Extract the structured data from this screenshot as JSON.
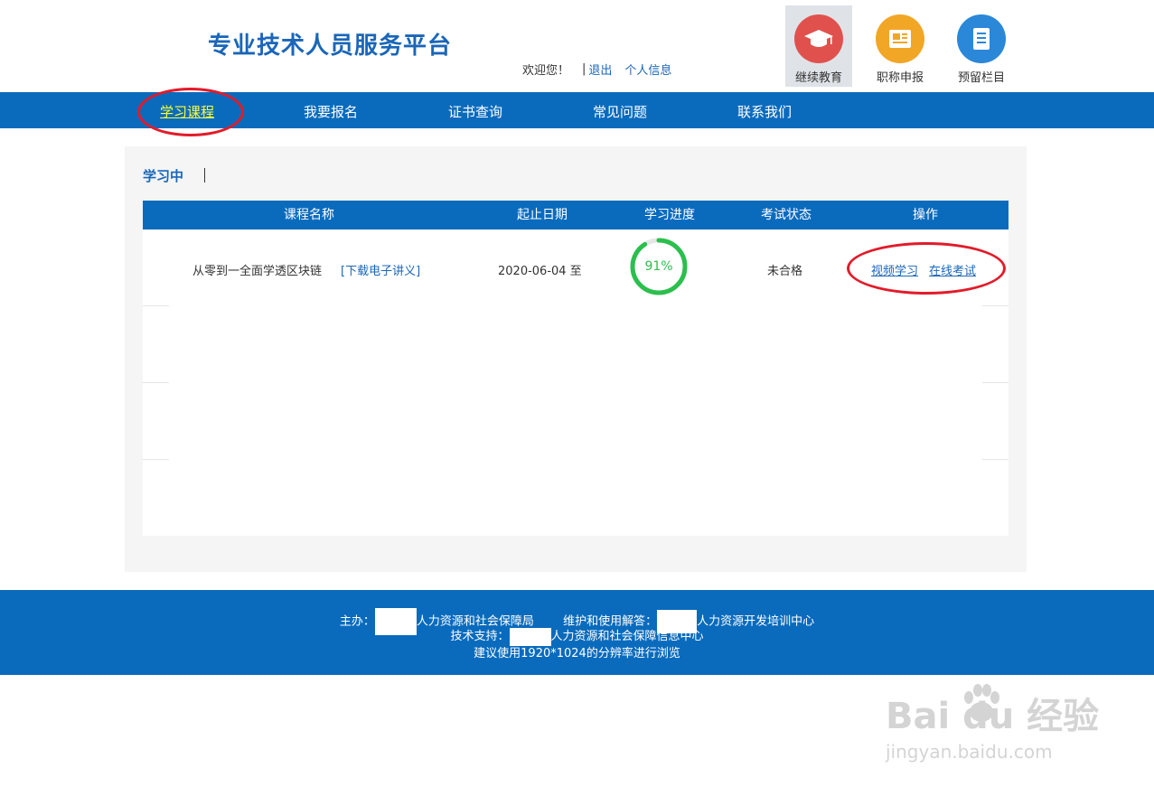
{
  "header": {
    "site_title": "专业技术人员服务平台",
    "welcome": "欢迎您！",
    "sep": "|",
    "logout": "退出",
    "profile": "个人信息"
  },
  "top_icons": [
    {
      "label": "继续教育",
      "icon": "graduation-cap-icon",
      "color": "#e0514e",
      "active": true
    },
    {
      "label": "职称申报",
      "icon": "newspaper-icon",
      "color": "#f2a626",
      "active": false
    },
    {
      "label": "预留栏目",
      "icon": "document-icon",
      "color": "#2b87d8",
      "active": false
    }
  ],
  "nav": {
    "items": [
      "学习课程",
      "我要报名",
      "证书查询",
      "常见问题",
      "联系我们"
    ],
    "active_index": 0
  },
  "panel": {
    "tab_label": "学习中",
    "tab_sep": "|",
    "columns": [
      "课程名称",
      "起止日期",
      "学习进度",
      "考试状态",
      "操作"
    ],
    "rows": [
      {
        "course_name": "从零到一全面学透区块链",
        "download": "[下载电子讲义]",
        "date": "2020-06-04 至",
        "progress_text": "91%",
        "progress_value": 91,
        "exam_status": "未合格",
        "action_video": "视频学习",
        "action_exam": "在线考试"
      }
    ]
  },
  "footer": {
    "host_label": "主办：",
    "host_org": "人力资源和社会保障局",
    "maint_label": "维护和使用解答：",
    "maint_org": "人力资源开发培训中心",
    "tech_label": "技术支持：",
    "tech_org": "人力资源和社会保障信息中心",
    "resolution_note": "建议使用1920*1024的分辨率进行浏览"
  },
  "watermark": {
    "brand": "Bai du 经验",
    "url": "jingyan.baidu.com"
  },
  "colors": {
    "primary": "#0a6bbd",
    "title_blue": "#1a66b8",
    "active_nav": "#f7ff3a",
    "progress_green": "#2bbf4d",
    "annotation_red": "#e21b2a"
  }
}
